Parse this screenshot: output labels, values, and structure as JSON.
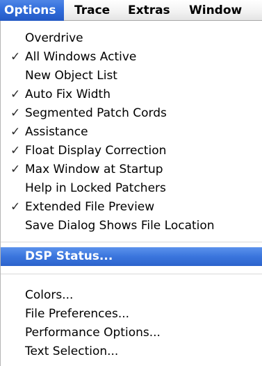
{
  "menubar": {
    "items": [
      {
        "label": "Options",
        "active": true
      },
      {
        "label": "Trace",
        "active": false
      },
      {
        "label": "Extras",
        "active": false
      },
      {
        "label": "Window",
        "active": false
      }
    ]
  },
  "menu": {
    "check_glyph": "✓",
    "items": [
      {
        "label": "Overdrive",
        "checked": false
      },
      {
        "label": "All Windows Active",
        "checked": true
      },
      {
        "label": "New Object List",
        "checked": false
      },
      {
        "label": "Auto Fix Width",
        "checked": true
      },
      {
        "label": "Segmented Patch Cords",
        "checked": true
      },
      {
        "label": "Assistance",
        "checked": true
      },
      {
        "label": "Float Display Correction",
        "checked": true
      },
      {
        "label": "Max Window at Startup",
        "checked": true
      },
      {
        "label": "Help in Locked Patchers",
        "checked": false
      },
      {
        "label": "Extended File Preview",
        "checked": true
      },
      {
        "label": "Save Dialog Shows File Location",
        "checked": false
      },
      {
        "label": "DSP Status...",
        "checked": false,
        "highlighted": true
      },
      {
        "label": "Colors...",
        "checked": false
      },
      {
        "label": "File Preferences...",
        "checked": false
      },
      {
        "label": "Performance Options...",
        "checked": false
      },
      {
        "label": "Text Selection...",
        "checked": false
      }
    ]
  },
  "colors": {
    "highlight": "#3a75dd",
    "highlight_text": "#ffffff"
  }
}
